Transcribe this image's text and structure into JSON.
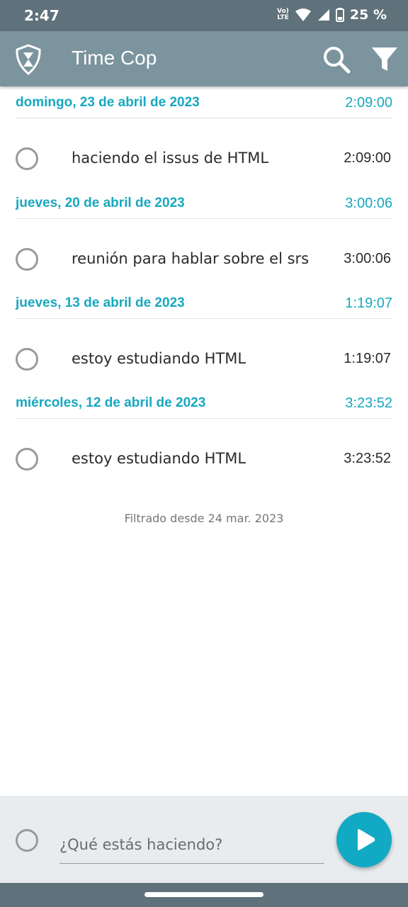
{
  "status_bar": {
    "time": "2:47",
    "volte_top": "Vo)",
    "volte_bottom": "LTE",
    "battery": "25 %",
    "icons": [
      "volte-icon",
      "wifi-icon",
      "signal-icon",
      "battery-icon"
    ]
  },
  "app_bar": {
    "title": "Time Cop",
    "logo_icon": "badge-hourglass-icon",
    "actions": [
      "search-icon",
      "filter-icon"
    ]
  },
  "groups": [
    {
      "date": "domingo, 23 de abril de 2023",
      "total": "2:09:00",
      "entries": [
        {
          "description": "haciendo el issus de HTML",
          "duration": "2:09:00"
        }
      ]
    },
    {
      "date": "jueves, 20 de abril de 2023",
      "total": "3:00:06",
      "entries": [
        {
          "description": "reunión para hablar sobre el srs",
          "duration": "3:00:06"
        }
      ]
    },
    {
      "date": "jueves, 13 de abril de 2023",
      "total": "1:19:07",
      "entries": [
        {
          "description": "estoy estudiando HTML",
          "duration": "1:19:07"
        }
      ]
    },
    {
      "date": "miércoles, 12 de abril de 2023",
      "total": "3:23:52",
      "entries": [
        {
          "description": "estoy estudiando HTML",
          "duration": "3:23:52"
        }
      ]
    }
  ],
  "filter_note": "Filtrado desde 24 mar. 2023",
  "new_entry": {
    "placeholder": "¿Qué estás haciendo?",
    "value": ""
  },
  "colors": {
    "app_bar": "#7b949e",
    "status_bar": "#5f717a",
    "accent": "#17a8bf",
    "fab": "#12a9c5"
  }
}
